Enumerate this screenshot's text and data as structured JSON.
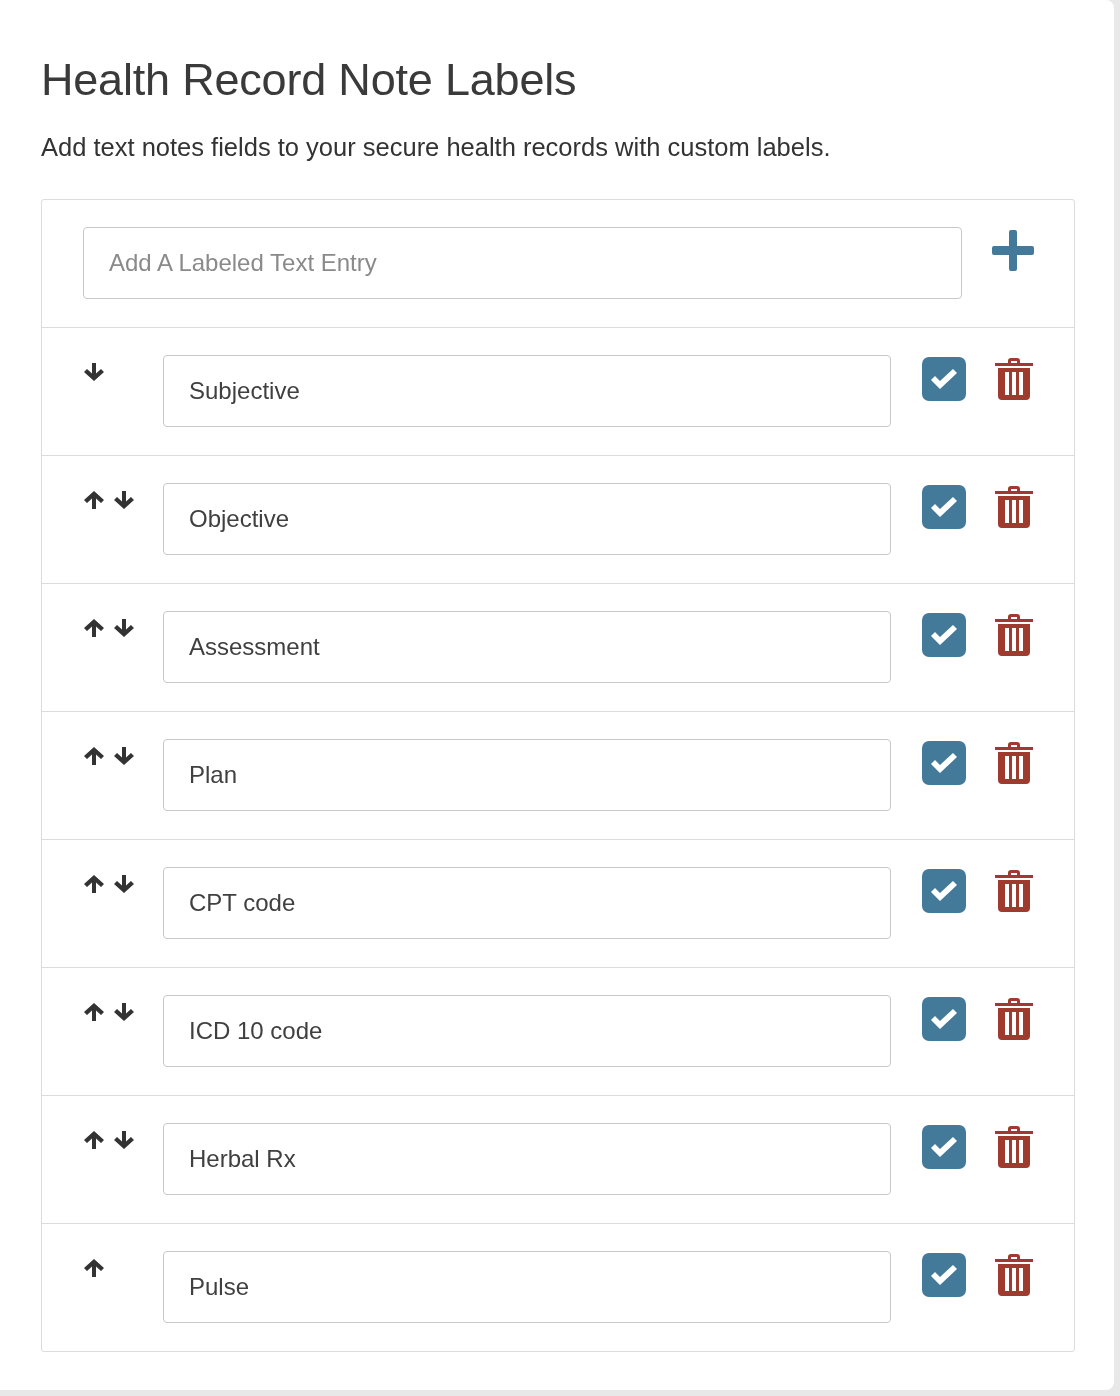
{
  "title": "Health Record Note Labels",
  "description": "Add text notes fields to your secure health records with custom labels.",
  "new_entry": {
    "placeholder": "Add A Labeled Text Entry"
  },
  "rows": [
    {
      "label": "Subjective",
      "move_up": false,
      "move_down": true,
      "checked": true
    },
    {
      "label": "Objective",
      "move_up": true,
      "move_down": true,
      "checked": true
    },
    {
      "label": "Assessment",
      "move_up": true,
      "move_down": true,
      "checked": true
    },
    {
      "label": "Plan",
      "move_up": true,
      "move_down": true,
      "checked": true
    },
    {
      "label": "CPT code",
      "move_up": true,
      "move_down": true,
      "checked": true
    },
    {
      "label": "ICD 10 code",
      "move_up": true,
      "move_down": true,
      "checked": true
    },
    {
      "label": "Herbal Rx",
      "move_up": true,
      "move_down": true,
      "checked": true
    },
    {
      "label": "Pulse",
      "move_up": true,
      "move_down": false,
      "checked": true
    }
  ]
}
